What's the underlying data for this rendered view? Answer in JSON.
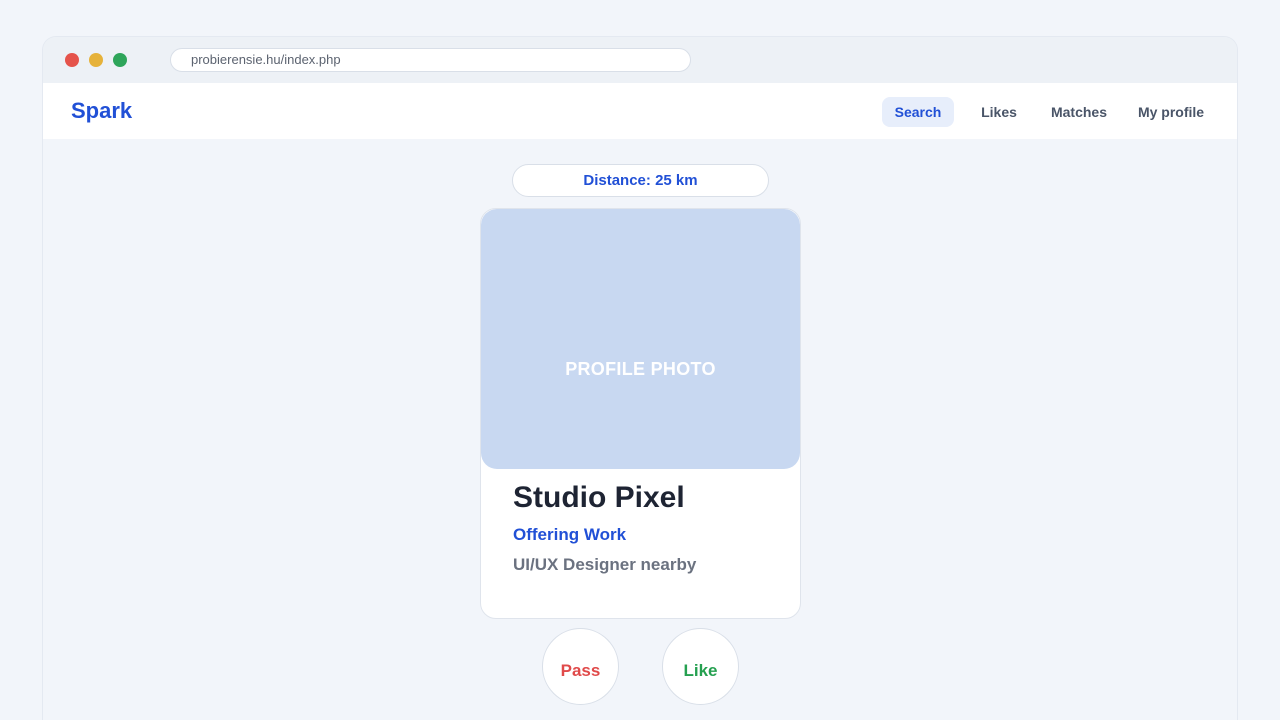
{
  "browser": {
    "url": "probierensie.hu/index.php"
  },
  "header": {
    "logo": "Spark",
    "nav": {
      "search": "Search",
      "likes": "Likes",
      "matches": "Matches",
      "my_profile": "My profile"
    },
    "active_nav": "Search"
  },
  "filter": {
    "distance_label": "Distance: 25 km"
  },
  "profile": {
    "photo_placeholder": "PROFILE PHOTO",
    "name": "Studio Pixel",
    "status": "Offering Work",
    "description": "UI/UX Designer nearby"
  },
  "actions": {
    "pass": "Pass",
    "like": "Like"
  },
  "colors": {
    "accent": "#2150d6",
    "pass": "#e04a4a",
    "like": "#25a050",
    "photo_bg": "#c8d8f1"
  }
}
